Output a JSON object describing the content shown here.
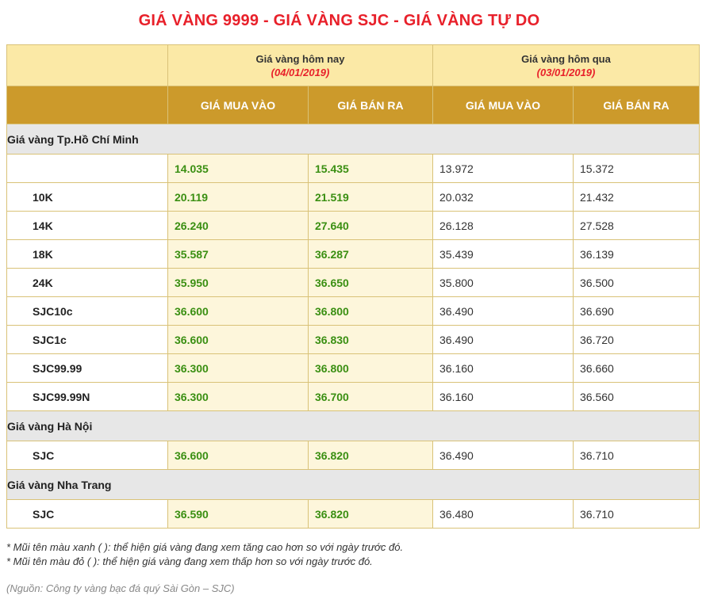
{
  "title": "GIÁ VÀNG 9999 - GIÁ VÀNG SJC - GIÁ VÀNG TỰ DO",
  "header": {
    "today_label": "Giá vàng hôm nay",
    "today_date": "(04/01/2019)",
    "yesterday_label": "Giá vàng hôm qua",
    "yesterday_date": "(03/01/2019)",
    "buy": "GIÁ MUA VÀO",
    "sell": "GIÁ BÁN RA"
  },
  "sections": [
    {
      "name": "Giá vàng Tp.Hồ Chí Minh",
      "rows": [
        {
          "label": "",
          "today_buy": "14.035",
          "today_sell": "15.435",
          "yest_buy": "13.972",
          "yest_sell": "15.372"
        },
        {
          "label": "10K",
          "today_buy": "20.119",
          "today_sell": "21.519",
          "yest_buy": "20.032",
          "yest_sell": "21.432"
        },
        {
          "label": "14K",
          "today_buy": "26.240",
          "today_sell": "27.640",
          "yest_buy": "26.128",
          "yest_sell": "27.528"
        },
        {
          "label": "18K",
          "today_buy": "35.587",
          "today_sell": "36.287",
          "yest_buy": "35.439",
          "yest_sell": "36.139"
        },
        {
          "label": "24K",
          "today_buy": "35.950",
          "today_sell": "36.650",
          "yest_buy": "35.800",
          "yest_sell": "36.500"
        },
        {
          "label": "SJC10c",
          "today_buy": "36.600",
          "today_sell": "36.800",
          "yest_buy": "36.490",
          "yest_sell": "36.690"
        },
        {
          "label": "SJC1c",
          "today_buy": "36.600",
          "today_sell": "36.830",
          "yest_buy": "36.490",
          "yest_sell": "36.720"
        },
        {
          "label": "SJC99.99",
          "today_buy": "36.300",
          "today_sell": "36.800",
          "yest_buy": "36.160",
          "yest_sell": "36.660"
        },
        {
          "label": "SJC99.99N",
          "today_buy": "36.300",
          "today_sell": "36.700",
          "yest_buy": "36.160",
          "yest_sell": "36.560"
        }
      ]
    },
    {
      "name": "Giá vàng Hà Nội",
      "rows": [
        {
          "label": "SJC",
          "today_buy": "36.600",
          "today_sell": "36.820",
          "yest_buy": "36.490",
          "yest_sell": "36.710"
        }
      ]
    },
    {
      "name": "Giá vàng Nha Trang",
      "rows": [
        {
          "label": "SJC",
          "today_buy": "36.590",
          "today_sell": "36.820",
          "yest_buy": "36.480",
          "yest_sell": "36.710"
        }
      ]
    }
  ],
  "notes": {
    "green": "* Mũi tên màu xanh ( ): thể hiện giá vàng đang xem tăng cao hơn so với ngày trước đó.",
    "red": "* Mũi tên màu đỏ ( ): thể hiện giá vàng đang xem thấp hơn so với ngày trước đó.",
    "source": "(Nguồn: Công ty vàng bạc đá quý Sài Gòn – SJC)"
  },
  "colors": {
    "title": "#e8202a",
    "header_light": "#fbe9a6",
    "header_dark": "#cc9a2b",
    "today_value": "#3a8f12",
    "section_bg": "#e7e7e7"
  }
}
